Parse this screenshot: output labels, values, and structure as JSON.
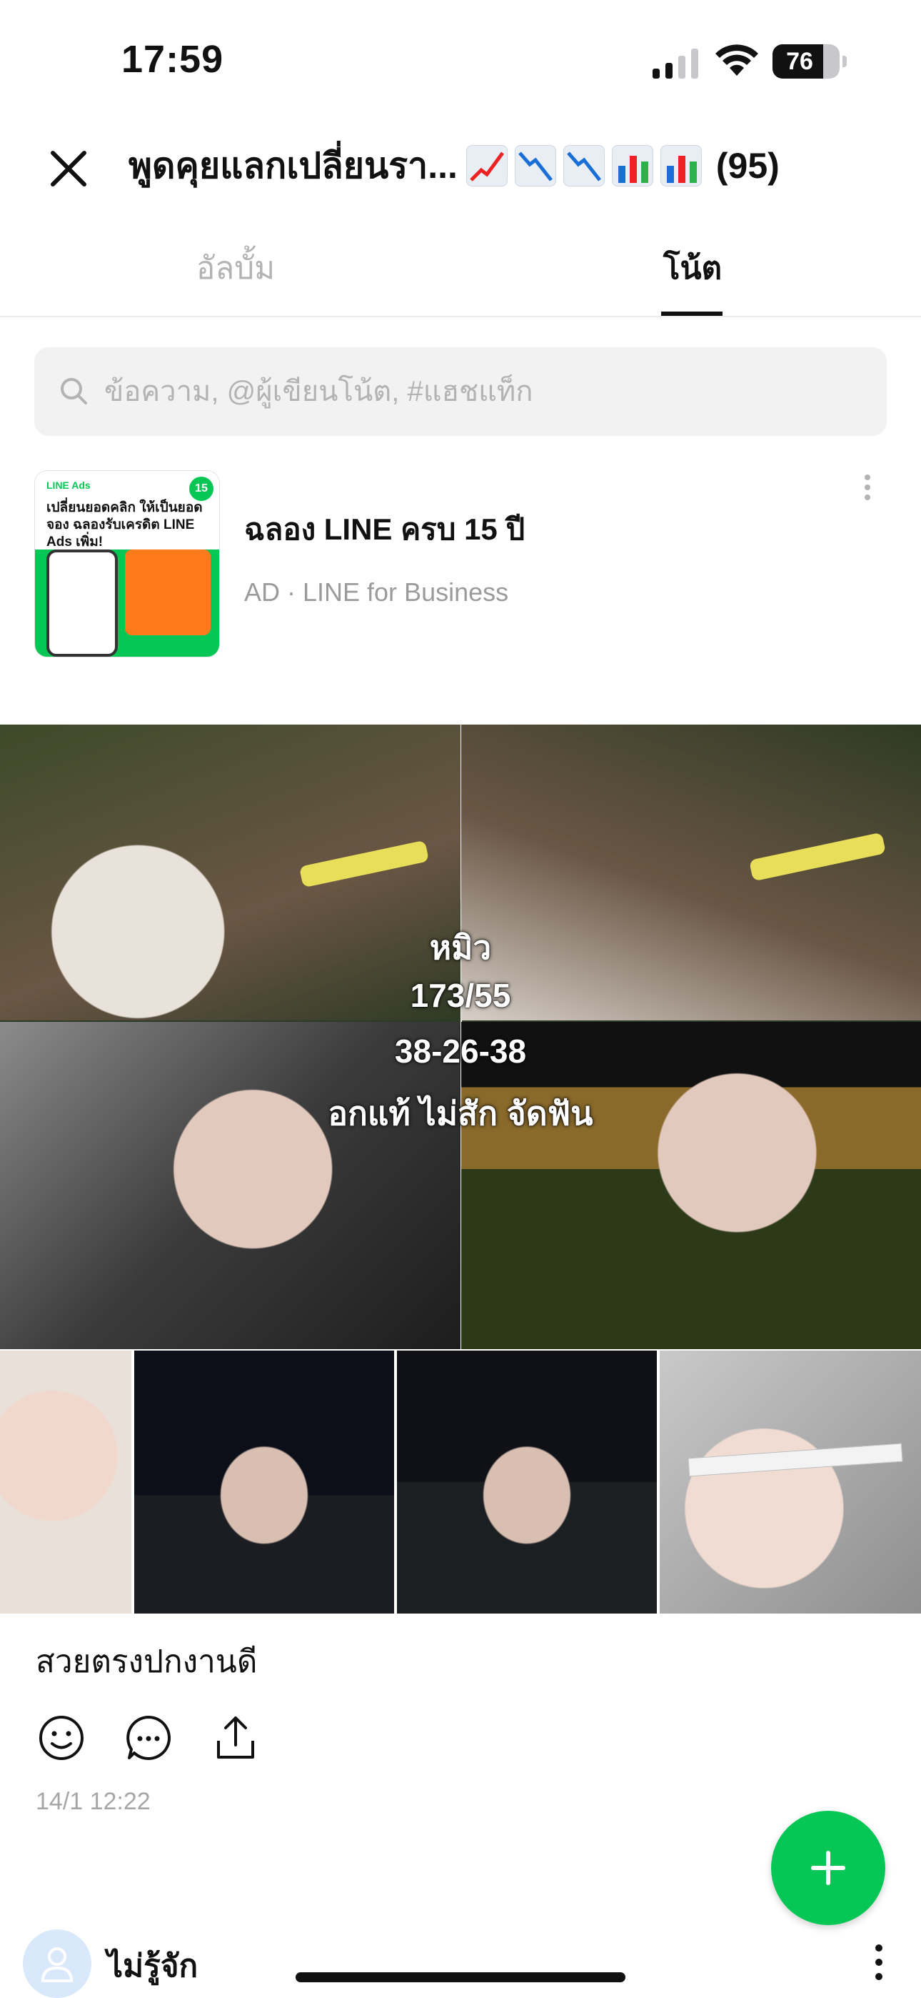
{
  "status_bar": {
    "time": "17:59",
    "battery": "76",
    "battery_level": 0.76
  },
  "header": {
    "title": "พูดคุยแลกเปลี่ยนรา...",
    "emoji_icons": [
      "chart-up-icon",
      "chart-down-icon",
      "chart-down-icon",
      "bar-chart-icon",
      "bar-chart-icon"
    ],
    "member_count": "(95)"
  },
  "tabs": [
    {
      "label": "อัลบั้ม",
      "active": false
    },
    {
      "label": "โน้ต",
      "active": true
    }
  ],
  "search": {
    "placeholder": "ข้อความ, @ผู้เขียนโน้ต, #แฮชแท็ก",
    "value": ""
  },
  "ad": {
    "thumb_text_small": "LINE Ads",
    "thumb_text_headline": "เปลี่ยนยอดคลิก ให้เป็นยอดจอง ฉลองรับเครดิต LINE Ads เพิ่ม!",
    "thumb_badge": "15",
    "title": "ฉลอง LINE ครบ 15 ปี",
    "subtitle": "AD · LINE for Business"
  },
  "post": {
    "overlay_lines": [
      "หมิว",
      "173/55",
      "38-26-38",
      "อกแท้ ไม่สัก จัดฟัน"
    ],
    "text": "สวยตรงปกงานดี",
    "timestamp": "14/1 12:22"
  },
  "next_post": {
    "author": "ไม่รู้จัก"
  },
  "colors": {
    "accent": "#06c755",
    "muted": "#b3b3b3"
  }
}
